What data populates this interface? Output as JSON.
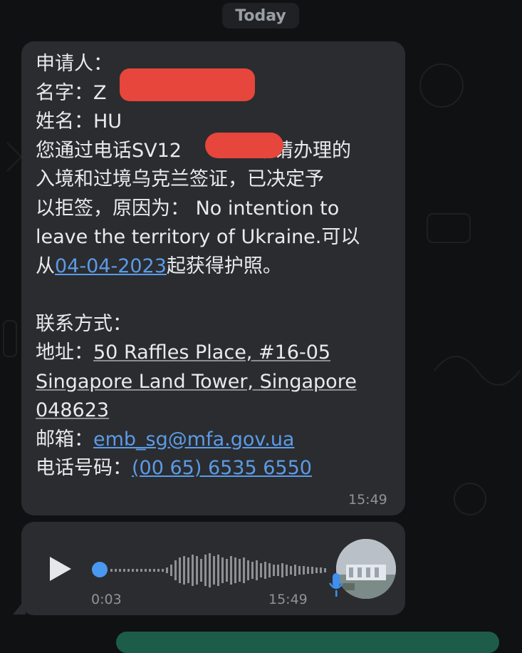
{
  "date_separator": "Today",
  "message": {
    "l1": "申请人：",
    "l2_label": "名字：",
    "l2_value": "Z",
    "l3_label": "姓名：",
    "l3_value": "HU",
    "l4_a": "您通过电话",
    "l4_b": "SV12",
    "l4_c": "申请办理的",
    "l5": "入境和过境乌克兰签证，已决定予",
    "l6": "以拒签，原因为： No intention to",
    "l7": "leave the territory of Ukraine.可以",
    "l8_a": "从",
    "date_link": "04-04-2023",
    "l8_b": "起获得护照。",
    "contact_title": "联系方式：",
    "address_label": "地址：",
    "address_1": "50 Raffles Place, #16-05",
    "address_2": "Singapore Land Tower, Singapore",
    "address_3": "048623",
    "email_label": "邮箱：",
    "email": "emb_sg@mfa.gov.ua",
    "phone_label": "电话号码：",
    "phone": "(00 65) 6535 6550",
    "time": "15:49"
  },
  "voice_message": {
    "duration": "0:03",
    "time": "15:49",
    "progress": 0
  },
  "colors": {
    "background": "#0f1113",
    "bubble": "#2b2c2f",
    "text": "#e9eaec",
    "link": "#5b9be8",
    "redaction": "#e6463b"
  }
}
